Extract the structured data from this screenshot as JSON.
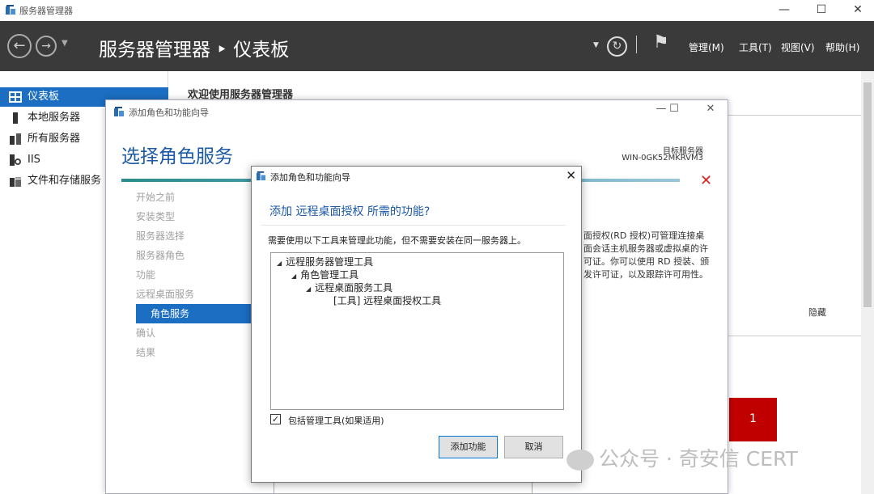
{
  "window": {
    "title": "服务器管理器",
    "minimize": "—",
    "maximize": "☐",
    "close": "✕"
  },
  "header": {
    "title": "服务器管理器 ‣ 仪表板",
    "menu": [
      "管理(M)",
      "工具(T)",
      "视图(V)",
      "帮助(H)"
    ],
    "refresh_icon": "↻",
    "flag_icon": "⚑"
  },
  "sidebar": {
    "items": [
      {
        "label": "仪表板",
        "selected": true
      },
      {
        "label": "本地服务器"
      },
      {
        "label": "所有服务器"
      },
      {
        "label": "IIS"
      },
      {
        "label": "文件和存储服务"
      }
    ]
  },
  "main": {
    "welcome": "欢迎使用服务器管理器",
    "hide": "隐藏",
    "tile_count": "1"
  },
  "wizard": {
    "title": "添加角色和功能向导",
    "heading": "选择角色服务",
    "target_label": "目标服务器",
    "target_value": "WIN-0GK52MKRVM3",
    "steps": [
      "开始之前",
      "安装类型",
      "服务器选择",
      "服务器角色",
      "功能",
      "远程桌面服务",
      "角色服务",
      "确认",
      "结果"
    ],
    "selected_step": "角色服务",
    "description": "面授权(RD 授权)可管理连接桌面会话主机服务器或虚拟桌的许可证。你可以使用 RD 授装、颁发许可证，以及跟踪许可用性。"
  },
  "dialog": {
    "title": "添加角色和功能向导",
    "question": "添加 远程桌面授权 所需的功能?",
    "message": "需要使用以下工具来管理此功能，但不需要安装在同一服务器上。",
    "tree": [
      {
        "label": "远程服务器管理工具",
        "level": 0,
        "expand": true
      },
      {
        "label": "角色管理工具",
        "level": 1,
        "expand": true
      },
      {
        "label": "远程桌面服务工具",
        "level": 2,
        "expand": true
      },
      {
        "label": "[工具] 远程桌面授权工具",
        "level": 3,
        "expand": false
      }
    ],
    "include_tools_label": "包括管理工具(如果适用)",
    "include_tools_checked": true,
    "add_button": "添加功能",
    "cancel_button": "取消"
  },
  "watermark": "公众号 · 奇安信 CERT"
}
